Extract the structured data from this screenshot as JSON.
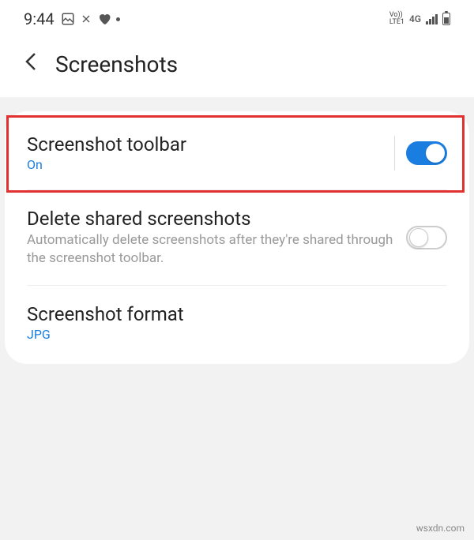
{
  "status": {
    "time": "9:44",
    "net_top": "Vo))",
    "net_bottom": "LTE1",
    "net_gen": "4G"
  },
  "header": {
    "title": "Screenshots"
  },
  "settings": {
    "toolbar": {
      "title": "Screenshot toolbar",
      "status": "On",
      "enabled": true
    },
    "delete": {
      "title": "Delete shared screenshots",
      "description": "Automatically delete screenshots after they're shared through the screenshot toolbar.",
      "enabled": false
    },
    "format": {
      "title": "Screenshot format",
      "value": "JPG"
    }
  },
  "watermark": "wsxdn.com"
}
